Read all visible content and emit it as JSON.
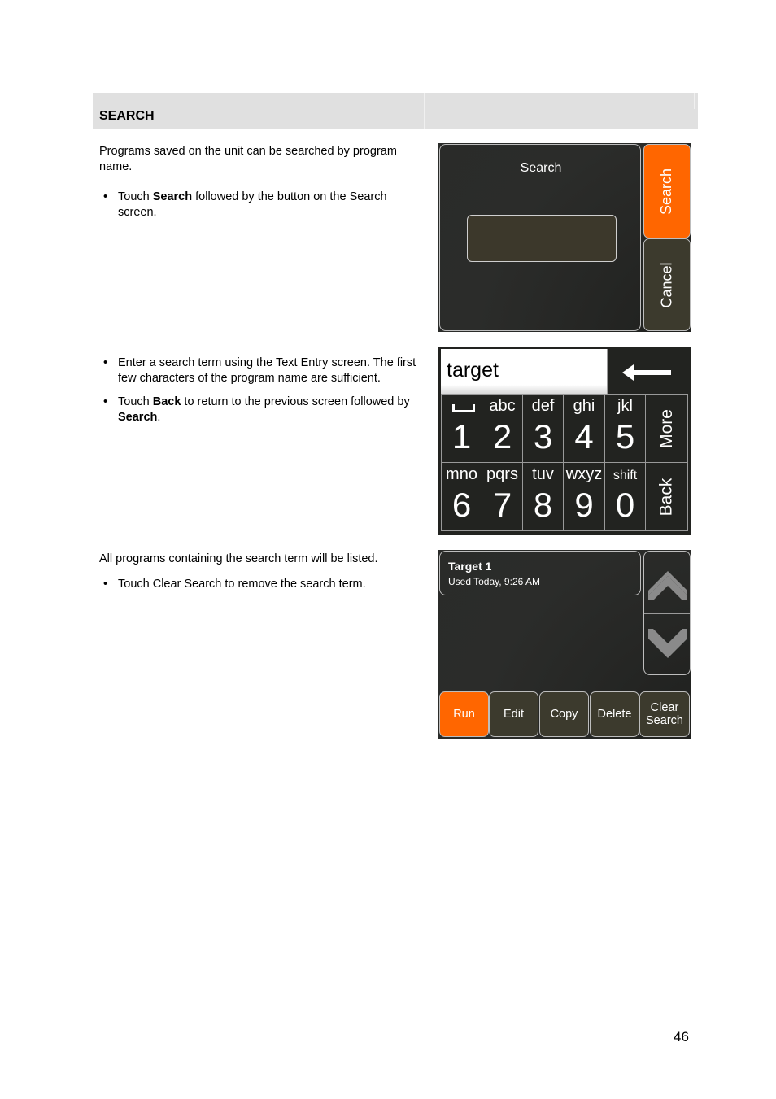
{
  "section": {
    "title": "SEARCH"
  },
  "block1": {
    "intro": "Programs saved on the unit can be searched by program name.",
    "bullets": [
      {
        "pre": "Touch ",
        "bold": "Search",
        "post": " followed by the button on the Search screen."
      }
    ]
  },
  "block2": {
    "bullets": [
      {
        "text": "Enter a search term using the Text Entry screen. The first few characters of the program name are sufficient."
      },
      {
        "pre": "Touch ",
        "bold": "Back",
        "mid": " to return to the previous screen followed by ",
        "bold2": "Search",
        "post": "."
      }
    ]
  },
  "block3": {
    "intro": "All programs containing the search term will be listed.",
    "bullets": [
      {
        "text": "Touch Clear Search to remove the search term."
      }
    ]
  },
  "screen1": {
    "title": "Search",
    "input_value": "",
    "search_button": "Search",
    "cancel_button": "Cancel",
    "accent": "#ff6600"
  },
  "screen2": {
    "entry_value": "target",
    "backspace_icon": "left-arrow-icon",
    "keys": [
      {
        "letters": "",
        "digit": "1",
        "icon": "space-icon"
      },
      {
        "letters": "abc",
        "digit": "2"
      },
      {
        "letters": "def",
        "digit": "3"
      },
      {
        "letters": "ghi",
        "digit": "4"
      },
      {
        "letters": "jkl",
        "digit": "5"
      },
      {
        "letters": "mno",
        "digit": "6"
      },
      {
        "letters": "pqrs",
        "digit": "7"
      },
      {
        "letters": "tuv",
        "digit": "8"
      },
      {
        "letters": "wxyz",
        "digit": "9"
      },
      {
        "letters": "shift",
        "digit": "0"
      }
    ],
    "more_button": "More",
    "back_button": "Back"
  },
  "screen3": {
    "result": {
      "name": "Target 1",
      "detail": "Used Today, 9:26 AM"
    },
    "buttons": {
      "run": "Run",
      "edit": "Edit",
      "copy": "Copy",
      "delete": "Delete",
      "clear_line1": "Clear",
      "clear_line2": "Search"
    },
    "scroll_up_icon": "chevron-up-icon",
    "scroll_down_icon": "chevron-down-icon"
  },
  "page_number": "46"
}
